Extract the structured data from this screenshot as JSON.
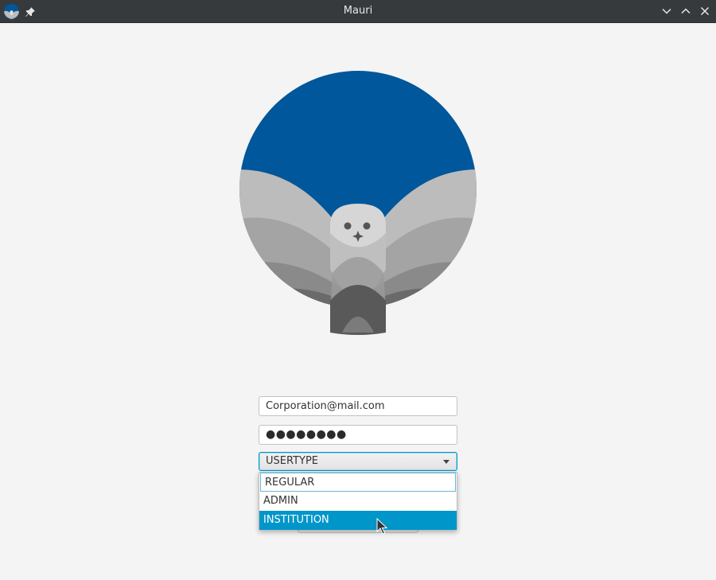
{
  "window": {
    "title": "Mauri",
    "controls": [
      "minimize",
      "maximize",
      "close"
    ]
  },
  "logo": {
    "description_icon": "owl-logo-icon",
    "brand_color": "#01579b"
  },
  "login": {
    "email_value": "Corporation@mail.com",
    "password_masked": "●●●●●●●●",
    "usertype_prompt": "USERTYPE",
    "usertype_options": [
      "REGULAR",
      "ADMIN",
      "INSTITUTION"
    ],
    "highlighted_option": "INSTITUTION"
  },
  "colors": {
    "titlebar": "#373a3c",
    "background": "#f4f4f4",
    "accent": "#0096c9"
  }
}
